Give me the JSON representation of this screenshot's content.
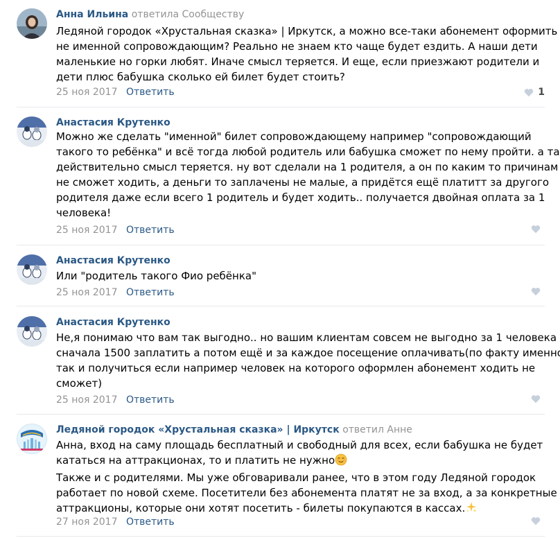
{
  "comments": [
    {
      "author": "Анна Ильина",
      "reply_to": "ответила Сообществу",
      "lines": [
        "Ледяной городок «Хрустальная сказка» | Иркутск, а можно все-таки абонемент оформить",
        "не именной сопровождающим? Реально не знаем кто чаще будет ездить. А наши дети",
        "маленькие но горки любят. Иначе смысл теряется. И еще, если приезжают родители и",
        "дети плюс бабушка сколько ей билет будет стоить?"
      ],
      "date": "25 ноя 2017",
      "reply_label": "Ответить",
      "like_count": "1",
      "avatar_icon": "user-photo-icon"
    },
    {
      "author": "Анастасия Крутенко",
      "reply_to": "",
      "lines": [
        "Можно же сделать \"именной\" билет сопровождающему например \"сопровождающий",
        "такого то ребёнка\" и всё тогда любой родитель или бабушка сможет по нему пройти. а так",
        "действительно смысл теряется. ну вот сделали на 1 родителя, а он по каким то причинам",
        "не сможет ходить, а деньги то заплачены не малые, а придётся ещё платитт за другого",
        "родителя даже если всего 1 родитель и будет ходить.. получается двойная оплата за 1",
        "человека!"
      ],
      "date": "25 ноя 2017",
      "reply_label": "Ответить",
      "like_count": "",
      "avatar_icon": "user-photo-icon"
    },
    {
      "author": "Анастасия Крутенко",
      "reply_to": "",
      "lines": [
        "Или \"родитель такого Фио ребёнка\""
      ],
      "date": "25 ноя 2017",
      "reply_label": "Ответить",
      "like_count": "",
      "avatar_icon": "user-photo-icon"
    },
    {
      "author": "Анастасия Крутенко",
      "reply_to": "",
      "lines": [
        "Не,я понимаю что вам так выгодно.. но вашим клиентам совсем не выгодно за 1 человека",
        "сначала 1500 заплатить а потом ещё и за каждое посещение оплачивать(по факту именно",
        "так и получиться если например человек на которого оформлен абонемент ходить не",
        "сможет)"
      ],
      "date": "25 ноя 2017",
      "reply_label": "Ответить",
      "like_count": "",
      "avatar_icon": "user-photo-icon"
    },
    {
      "author": "Ледяной городок «Хрустальная сказка» | Иркутск",
      "reply_to": "ответил Анне",
      "lines": [
        "Анна, вход на саму площадь бесплатный и свободный для всех, если бабушка не будет",
        "кататься на аттракционах, то и платить не нужно",
        "Также и с родителями. Мы уже обговаривали ранее, что в этом году Ледяной городок",
        "работает по новой схеме. Посетители без абонемента платят не за вход, а за конкретные",
        "аттракционы, которые они хотят посетить - билеты покупаются в кассах."
      ],
      "date": "27 ноя 2017",
      "reply_label": "Ответить",
      "like_count": "",
      "avatar_icon": "community-logo-icon"
    }
  ],
  "icons": {
    "like": "heart-icon",
    "emoji_relieved": "relieved-face-emoji-icon",
    "emoji_sparkles": "sparkles-emoji-icon"
  },
  "colors": {
    "link": "#2a5885",
    "muted": "#939393",
    "divider": "#e7e8ec",
    "heart": "#c5d0db"
  }
}
